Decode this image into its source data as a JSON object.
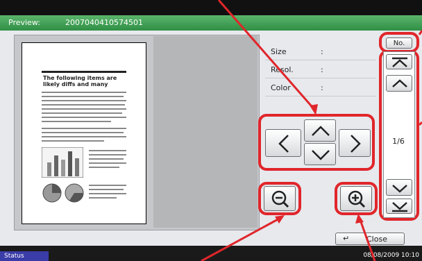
{
  "window": {
    "preview_label": "Preview:",
    "file_id": "2007040410574501"
  },
  "document_preview": {
    "title_line1": "The following items are",
    "title_line2": "likely diffs and many"
  },
  "info": {
    "rows": [
      {
        "key": "Size",
        "colon": ":"
      },
      {
        "key": "Resol.",
        "colon": ":"
      },
      {
        "key": "Color",
        "colon": ":"
      }
    ]
  },
  "navigation": {
    "number_button": "No.",
    "page_indicator": "1/6"
  },
  "actions": {
    "close_label": "Close",
    "close_icon": "return-icon"
  },
  "statusbar": {
    "status_label": "Status",
    "datetime": "08/08/2009   10:10"
  },
  "colors": {
    "title_green": "#3a9a4f",
    "highlight_red": "#e0262b",
    "status_blue": "#3a3ca8"
  }
}
